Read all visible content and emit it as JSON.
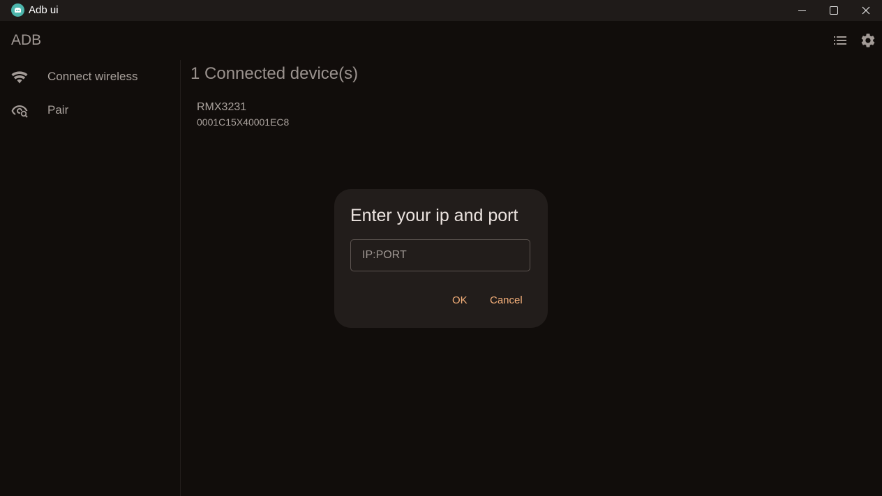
{
  "window": {
    "title": "Adb ui",
    "icon": "android-app-icon",
    "controls": [
      "minimize-icon",
      "maximize-icon",
      "close-icon"
    ]
  },
  "header": {
    "title": "ADB",
    "actions": [
      "list-icon",
      "gear-icon"
    ]
  },
  "sidebar": {
    "items": [
      {
        "label": "Connect wireless",
        "icon": "wifi-icon"
      },
      {
        "label": "Pair",
        "icon": "visibility-icon"
      }
    ]
  },
  "main": {
    "heading": "1 Connected device(s)",
    "devices": [
      {
        "name": "RMX3231",
        "serial": "0001C15X40001EC8"
      }
    ]
  },
  "dialog": {
    "title": "Enter your ip and port",
    "input": {
      "placeholder": "IP:PORT",
      "value": ""
    },
    "ok_label": "OK",
    "cancel_label": "Cancel"
  },
  "colors": {
    "background": "#110d0b",
    "titlebar": "#1f1b19",
    "dialog": "#221d1b",
    "accent": "#f5b07a",
    "app_icon": "#4db6ac"
  }
}
